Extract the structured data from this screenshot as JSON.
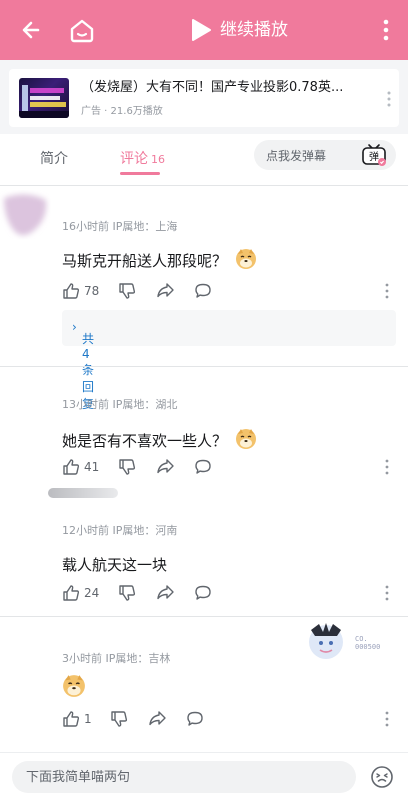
{
  "header": {
    "play_label": "继续播放",
    "accent_color": "#f07a9c",
    "icons": [
      "back-arrow-icon",
      "home-icon",
      "play-icon",
      "more-vertical-icon"
    ]
  },
  "ad": {
    "title": "（发烧屋）大有不同！国产专业投影0.78英...",
    "meta": "广告 · 21.6万播放"
  },
  "tabs": {
    "intro": "简介",
    "comments": "评论",
    "comments_count": "16",
    "danmu_placeholder": "点我发弹幕",
    "danmu_icon_glyph": "弹"
  },
  "comments": [
    {
      "time": "16小时前 IP属地：上海",
      "text": "马斯克开船送人那段呢？",
      "emoji": "doge",
      "likes": "78",
      "replies": "共4条回复"
    },
    {
      "time": "13小时前 IP属地：湖北",
      "text": "她是否有不喜欢一些人？",
      "emoji": "doge",
      "likes": "41"
    },
    {
      "time": "12小时前 IP属地：河南",
      "text": "载人航天这一块",
      "likes": "24"
    },
    {
      "time": "3小时前 IP属地：吉林",
      "emoji": "doge",
      "likes": "1",
      "badge_text": [
        "CO.",
        "000500"
      ]
    }
  ],
  "input": {
    "placeholder": "下面我简单喵两句"
  }
}
